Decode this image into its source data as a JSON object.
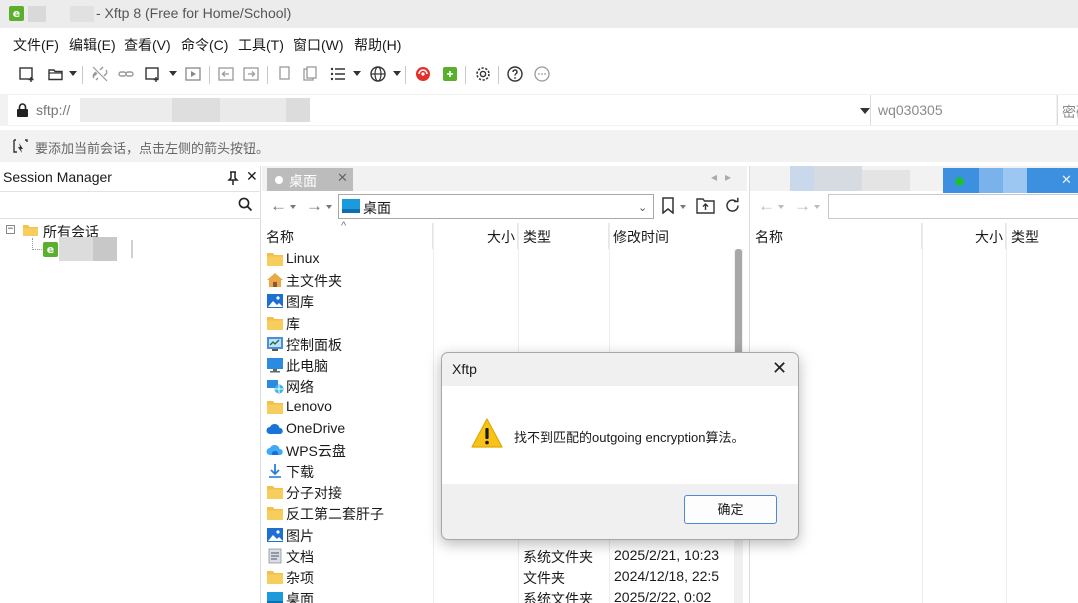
{
  "window": {
    "title": "- Xftp 8 (Free for Home/School)",
    "logo_letter": "e"
  },
  "menu": [
    {
      "label": "文件(F)"
    },
    {
      "label": "编辑(E)"
    },
    {
      "label": "查看(V)"
    },
    {
      "label": "命令(C)"
    },
    {
      "label": "工具(T)"
    },
    {
      "label": "窗口(W)"
    },
    {
      "label": "帮助(H)"
    }
  ],
  "toolbar": {
    "icons": [
      "new-session-icon",
      "open-folder-icon",
      "disconnect-icon",
      "reconnect-icon",
      "new-window-icon",
      "transfer-window-icon",
      "go-left-icon",
      "go-right-icon",
      "copy-icon",
      "paste-icon",
      "list-view-icon",
      "encoding-globe-icon",
      "xshell-icon",
      "xftp-icon",
      "settings-gear-icon",
      "help-icon",
      "chat-icon"
    ]
  },
  "address": {
    "value": "sftp://",
    "username_placeholder": "wq030305",
    "password_placeholder": "密码"
  },
  "hint": {
    "text": "要添加当前会话，点击左侧的箭头按钮。"
  },
  "session_manager": {
    "title": "Session Manager",
    "pin": "⌕",
    "close": "✕",
    "root_label": "所有会话",
    "collapse_symbol": "−"
  },
  "local_pane": {
    "tab_label": "桌面",
    "path": "桌面",
    "columns": {
      "name": "名称",
      "size": "大小",
      "type": "类型",
      "modified": "修改时间"
    },
    "files": [
      {
        "name": "Linux",
        "icon": "folder-icon",
        "type": "",
        "date": ""
      },
      {
        "name": "主文件夹",
        "icon": "home-icon",
        "type": "",
        "date": ""
      },
      {
        "name": "图库",
        "icon": "gallery-icon",
        "type": "",
        "date": ""
      },
      {
        "name": "库",
        "icon": "folder-icon",
        "type": "",
        "date": ""
      },
      {
        "name": "控制面板",
        "icon": "control-panel-icon",
        "type": "",
        "date": ""
      },
      {
        "name": "此电脑",
        "icon": "computer-icon",
        "type": "",
        "date": ""
      },
      {
        "name": "网络",
        "icon": "network-icon",
        "type": "",
        "date": ""
      },
      {
        "name": "Lenovo",
        "icon": "folder-icon",
        "type": "",
        "date": ""
      },
      {
        "name": "OneDrive",
        "icon": "cloud-icon",
        "type": "",
        "date": ""
      },
      {
        "name": "WPS云盘",
        "icon": "wps-cloud-icon",
        "type": "",
        "date": ""
      },
      {
        "name": "下载",
        "icon": "download-icon",
        "type": "",
        "date": ""
      },
      {
        "name": "分子对接",
        "icon": "folder-icon",
        "type": "",
        "date": ""
      },
      {
        "name": "反工第二套肝子",
        "icon": "folder-icon",
        "type": "",
        "date": ""
      },
      {
        "name": "图片",
        "icon": "pictures-icon",
        "type": "",
        "date": ""
      },
      {
        "name": "文档",
        "icon": "documents-icon",
        "type": "系统文件夹",
        "date": "2025/2/21, 10:23"
      },
      {
        "name": "杂项",
        "icon": "folder-icon",
        "type": "文件夹",
        "date": "2024/12/18, 22:5"
      },
      {
        "name": "桌面",
        "icon": "desktop-icon",
        "type": "系统文件夹",
        "date": "2025/2/22, 0:02"
      }
    ]
  },
  "remote_pane": {
    "columns": {
      "name": "名称",
      "size": "大小",
      "type": "类型"
    },
    "tab_close": "✕"
  },
  "dialog": {
    "title": "Xftp",
    "message": "找不到匹配的outgoing encryption算法。",
    "ok_label": "确定",
    "close": "✕"
  },
  "colors": {
    "accent_blue": "#3d8fe0",
    "status_green": "#1bbf3a",
    "warning_yellow": "#f7c318",
    "folder_yellow": "#f3c14b"
  }
}
